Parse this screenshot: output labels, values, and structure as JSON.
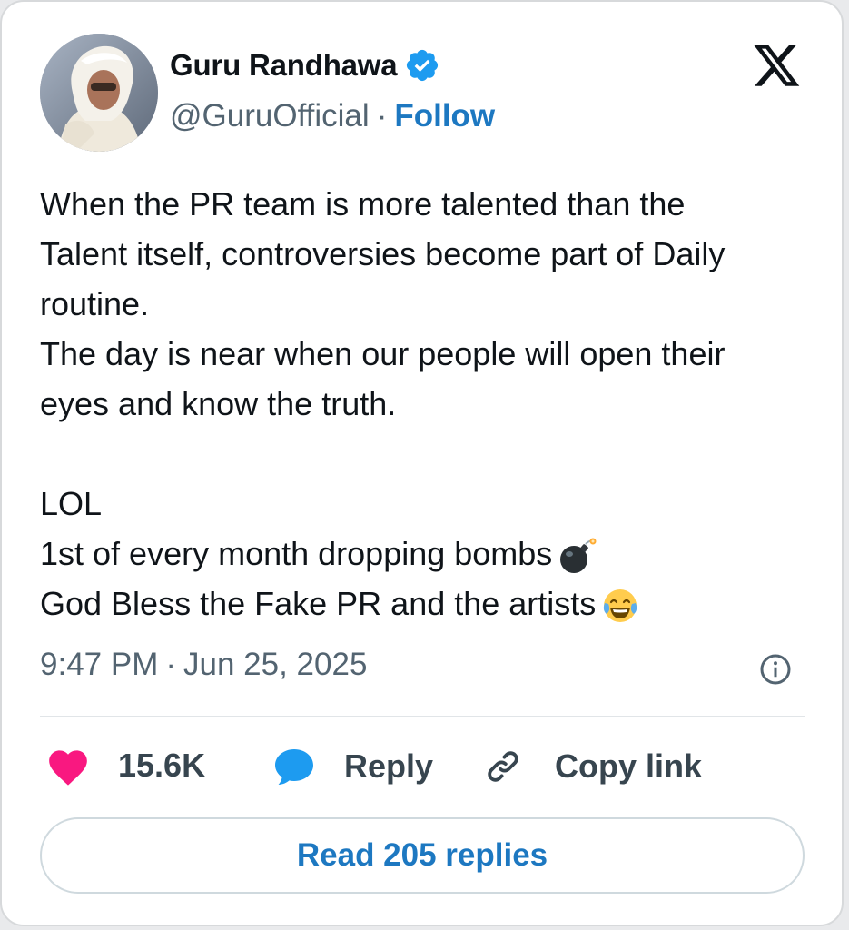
{
  "tweet": {
    "author_name": "Guru Randhawa",
    "handle": "@GuruOfficial",
    "separator": "·",
    "follow_label": "Follow",
    "lines": [
      "When the PR team is more talented than the",
      "Talent itself, controversies become part of Daily",
      "routine.",
      "The day is near when our people will open their",
      "eyes and know the truth.",
      "",
      "LOL",
      "1st of every month dropping bombs",
      "God Bless the Fake PR and the artists"
    ],
    "time": "9:47 PM",
    "date": "Jun 25, 2025",
    "likes": "15.6K",
    "reply_label": "Reply",
    "copy_link_label": "Copy link",
    "read_replies_label": "Read 205 replies"
  },
  "icons": {
    "verified": "verified-badge-icon",
    "platform": "x-logo-icon",
    "info": "info-icon",
    "like": "heart-icon",
    "reply": "speech-bubble-icon",
    "copy_link": "link-icon",
    "emoji_1": "bomb-emoji",
    "emoji_2": "tears-of-joy-emoji"
  },
  "colors": {
    "link_blue": "#1d78c1",
    "verified_blue": "#1d9bf0",
    "heart_pink": "#f91880",
    "text_dark": "#0f1419",
    "text_gray": "#536471"
  }
}
